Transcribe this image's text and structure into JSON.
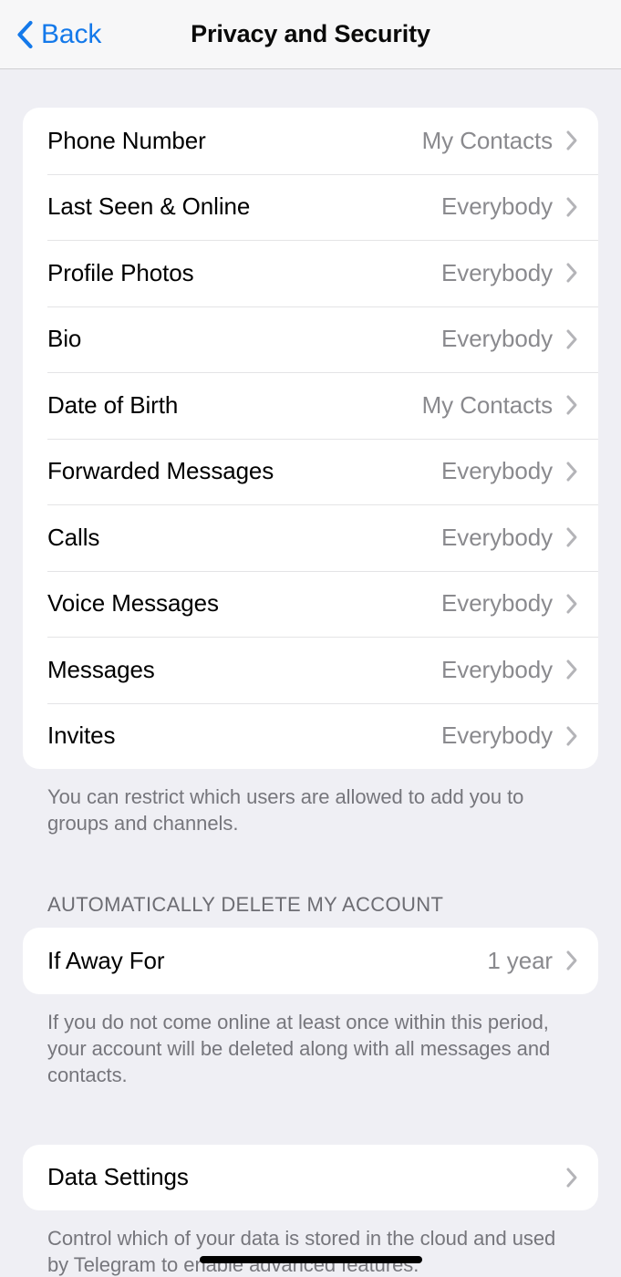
{
  "navbar": {
    "back_label": "Back",
    "title": "Privacy and Security",
    "back_icon": "chevron-left-icon",
    "accent_color": "#1479EA"
  },
  "privacy_section": {
    "rows": [
      {
        "label": "Phone Number",
        "value": "My Contacts"
      },
      {
        "label": "Last Seen & Online",
        "value": "Everybody"
      },
      {
        "label": "Profile Photos",
        "value": "Everybody"
      },
      {
        "label": "Bio",
        "value": "Everybody"
      },
      {
        "label": "Date of Birth",
        "value": "My Contacts"
      },
      {
        "label": "Forwarded Messages",
        "value": "Everybody"
      },
      {
        "label": "Calls",
        "value": "Everybody"
      },
      {
        "label": "Voice Messages",
        "value": "Everybody"
      },
      {
        "label": "Messages",
        "value": "Everybody"
      },
      {
        "label": "Invites",
        "value": "Everybody"
      }
    ],
    "footnote": "You can restrict which users are allowed to add you to groups and channels."
  },
  "auto_delete_section": {
    "header": "AUTOMATICALLY DELETE MY ACCOUNT",
    "rows": [
      {
        "label": "If Away For",
        "value": "1 year"
      }
    ],
    "footnote": "If you do not come online at least once within this period, your account will be deleted along with all messages and contacts."
  },
  "data_settings_section": {
    "rows": [
      {
        "label": "Data Settings",
        "value": ""
      }
    ],
    "footnote": "Control which of your data is stored in the cloud and used by Telegram to enable advanced features."
  },
  "icons": {
    "row_chevron": "chevron-right-icon",
    "home_indicator": "home-indicator"
  }
}
